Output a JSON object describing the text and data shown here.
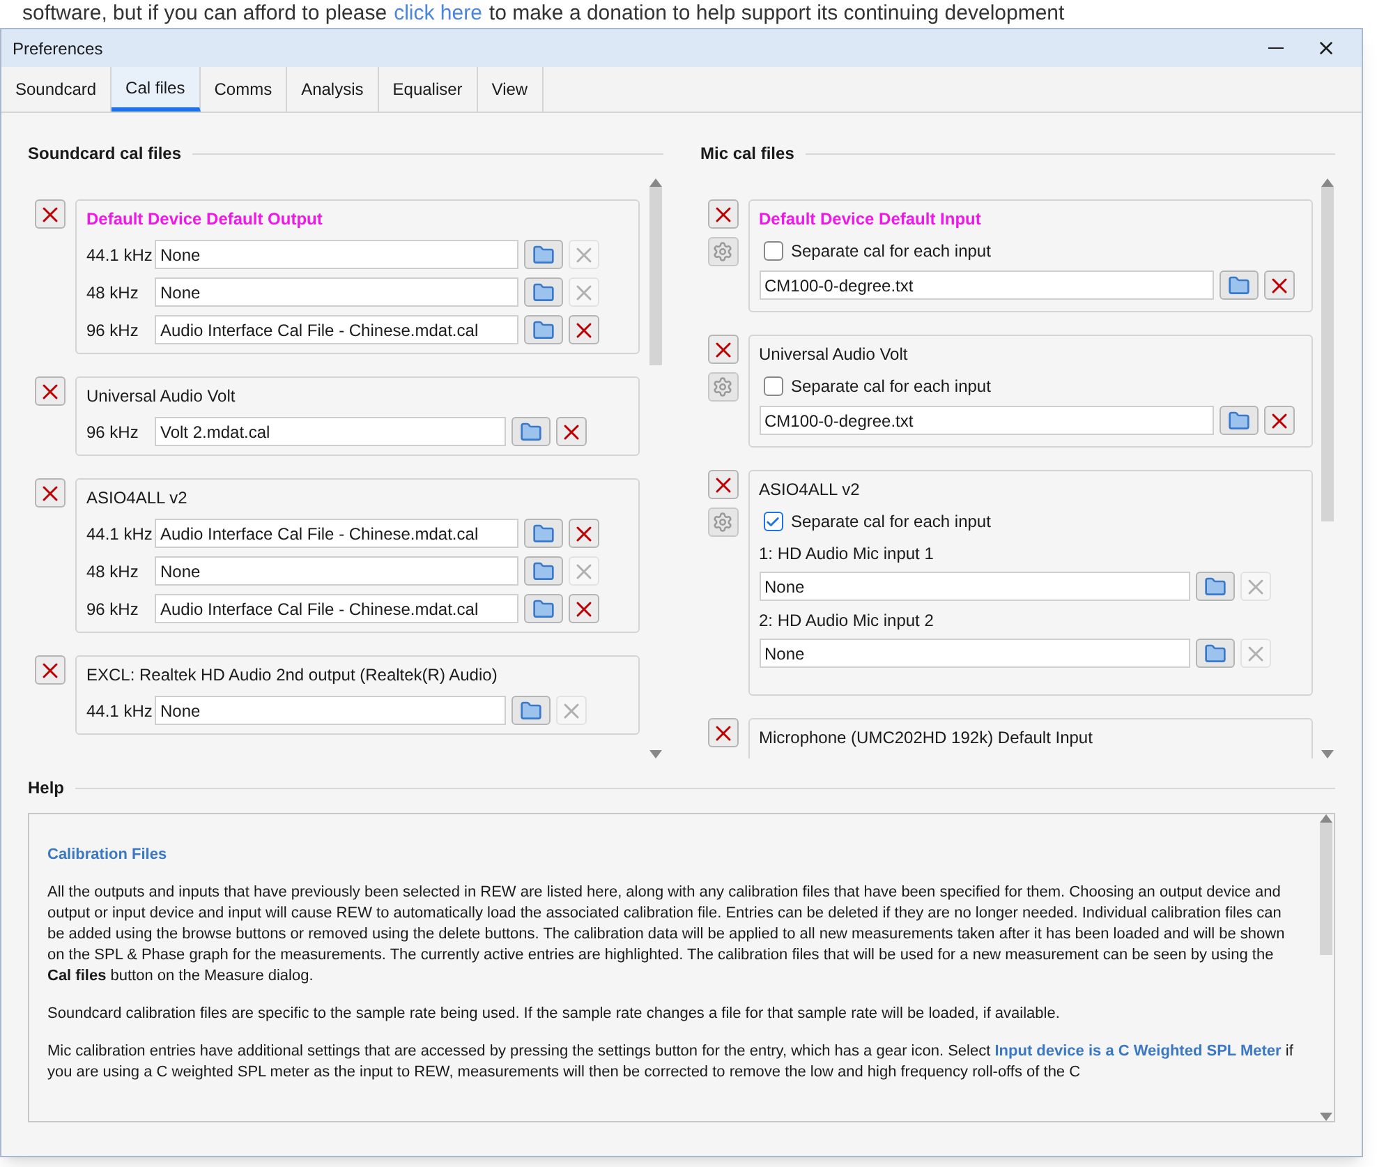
{
  "background_text": {
    "before": "software, but if you can afford to please",
    "link": "click here",
    "after": "to make a donation to help support its continuing development"
  },
  "window": {
    "title": "Preferences"
  },
  "tabs": [
    {
      "label": "Soundcard",
      "selected": false
    },
    {
      "label": "Cal files",
      "selected": true
    },
    {
      "label": "Comms",
      "selected": false
    },
    {
      "label": "Analysis",
      "selected": false
    },
    {
      "label": "Equaliser",
      "selected": false
    },
    {
      "label": "View",
      "selected": false
    }
  ],
  "soundcard_cal_files": {
    "heading": "Soundcard cal files",
    "entries": [
      {
        "title": "Default Device Default Output",
        "active": true,
        "rows": [
          {
            "rate": "44.1 kHz",
            "file": "None",
            "deletable": false
          },
          {
            "rate": "48 kHz",
            "file": "None",
            "deletable": false
          },
          {
            "rate": "96 kHz",
            "file": "Audio Interface Cal File - Chinese.mdat.cal",
            "deletable": true
          }
        ]
      },
      {
        "title": "Universal Audio Volt",
        "active": false,
        "rows": [
          {
            "rate": "96 kHz",
            "file": "Volt 2.mdat.cal",
            "deletable": true
          }
        ]
      },
      {
        "title": "ASIO4ALL v2",
        "active": false,
        "rows": [
          {
            "rate": "44.1 kHz",
            "file": "Audio Interface Cal File - Chinese.mdat.cal",
            "deletable": true
          },
          {
            "rate": "48 kHz",
            "file": "None",
            "deletable": false
          },
          {
            "rate": "96 kHz",
            "file": "Audio Interface Cal File - Chinese.mdat.cal",
            "deletable": true
          }
        ]
      },
      {
        "title": "EXCL: Realtek HD Audio 2nd output (Realtek(R) Audio)",
        "active": false,
        "rows": [
          {
            "rate": "44.1 kHz",
            "file": "None",
            "deletable": false
          }
        ]
      }
    ]
  },
  "mic_cal_files": {
    "heading": "Mic cal files",
    "entries": [
      {
        "title": "Default Device Default Input",
        "active": true,
        "separate_label": "Separate cal for each input",
        "separate": false,
        "file": "CM100-0-degree.txt",
        "deletable": true
      },
      {
        "title": "Universal Audio Volt",
        "active": false,
        "separate_label": "Separate cal for each input",
        "separate": false,
        "file": "CM100-0-degree.txt",
        "deletable": true
      },
      {
        "title": "ASIO4ALL v2",
        "active": false,
        "separate_label": "Separate cal for each input",
        "separate": true,
        "inputs": [
          {
            "label": "1: HD Audio Mic input 1",
            "file": "None",
            "deletable": false
          },
          {
            "label": "2: HD Audio Mic input 2",
            "file": "None",
            "deletable": false
          }
        ]
      },
      {
        "title": "Microphone (UMC202HD 192k) Default Input",
        "active": false
      }
    ]
  },
  "help": {
    "heading": "Help",
    "title": "Calibration Files",
    "paragraphs": [
      {
        "text": "All the outputs and inputs that have previously been selected in REW are listed here, along with any calibration files that have been specified for them. Choosing an output device and output or input device and input will cause REW to automatically load the associated calibration file. Entries can be deleted if they are no longer needed. Individual calibration files can be added using the browse buttons or removed using the delete buttons. The calibration data will be applied to all new measurements taken after it has been loaded and will be shown on the SPL & Phase graph for the measurements. The currently active entries are highlighted. The calibration files that will be used for a new measurement can be seen by using the **Cal files** button on the Measure dialog."
      },
      {
        "text": "Soundcard calibration files are specific to the sample rate being used. If the sample rate changes a file for that sample rate will be loaded, if available."
      },
      {
        "text": "Mic calibration entries have additional settings that are accessed by pressing the settings button for the entry, which has a gear icon. Select",
        "link": "Input device is a C Weighted SPL Meter",
        "after": "if you are using a C weighted SPL meter as the input to REW, measurements will then be corrected to remove the low and high frequency roll-offs of the C"
      }
    ]
  }
}
